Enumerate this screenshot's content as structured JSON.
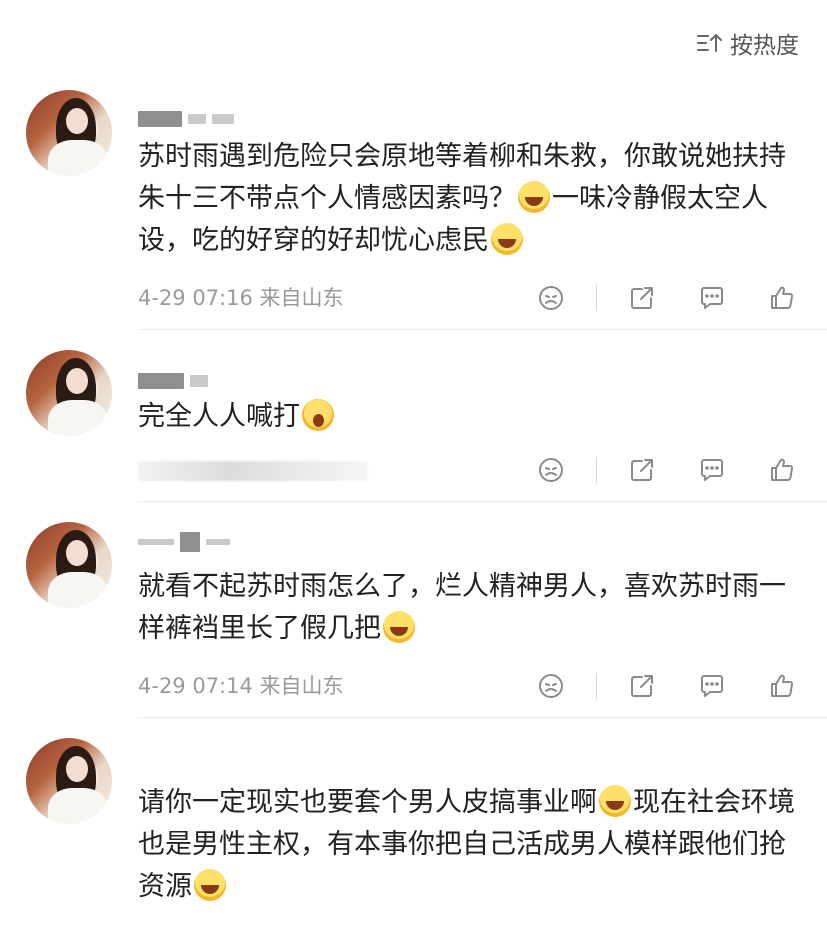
{
  "sort": {
    "label": "按热度",
    "icon": "sort-icon"
  },
  "comments": [
    {
      "text_parts": [
        "苏时雨遇到危险只会原地等着柳和朱救，你敢说她扶持朱十三不带点个人情感因素吗？",
        "一味冷静假太空人设，吃的好穿的好却忧心虑民"
      ],
      "meta": "4-29 07:16 来自山东"
    },
    {
      "text_parts": [
        "完全人人喊打"
      ],
      "meta": ""
    },
    {
      "text_parts": [
        "就看不起苏时雨怎么了，烂人精神男人，喜欢苏时雨一样裤裆里长了假几把"
      ],
      "meta": "4-29 07:14 来自山东"
    },
    {
      "text_parts": [
        "请你一定现实也要套个男人皮搞事业啊",
        "现在社会环境也是男性主权，有本事你把自己活成男人模样跟他们抢资源"
      ],
      "meta": ""
    }
  ],
  "icons": {
    "dislike": "dislike-icon",
    "share": "share-icon",
    "reply": "comment-icon",
    "like": "like-icon",
    "emoji": "laughing-emoji-icon"
  }
}
